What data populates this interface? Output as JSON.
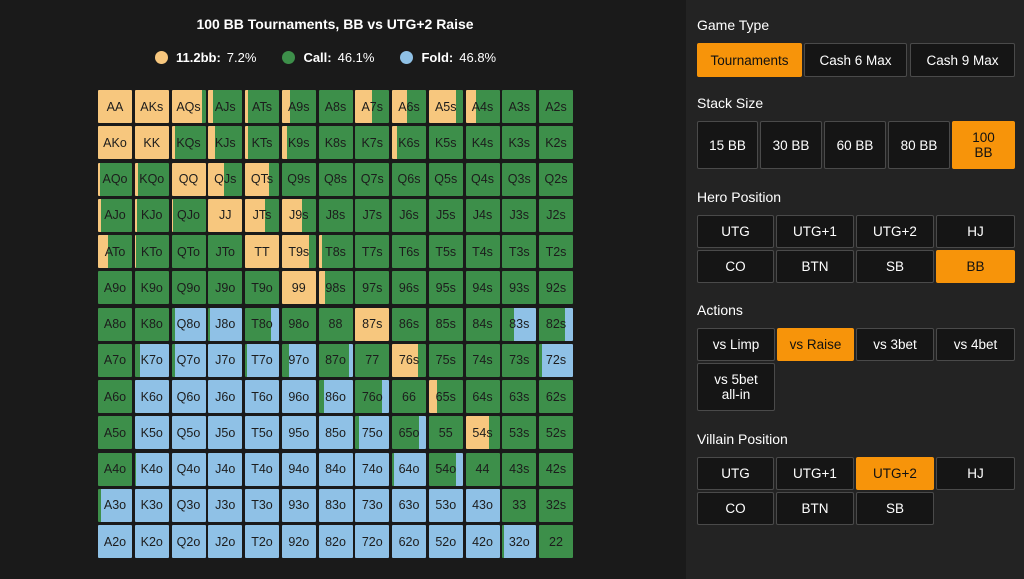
{
  "title": "100 BB Tournaments, BB vs UTG+2 Raise",
  "colors": {
    "raise": "#f7c77e",
    "call": "#3d8f4a",
    "fold": "#8fc1e6",
    "accent": "#f7940a"
  },
  "legend": [
    {
      "label": "11.2bb:",
      "pct": "7.2%",
      "color": "#f7c77e"
    },
    {
      "label": "Call:",
      "pct": "46.1%",
      "color": "#3d8f4a"
    },
    {
      "label": "Fold:",
      "pct": "46.8%",
      "color": "#8fc1e6"
    }
  ],
  "grid": [
    [
      [
        "AA",
        1,
        0
      ],
      [
        "AKs",
        1,
        0
      ],
      [
        "AQs",
        0.9,
        0.1
      ],
      [
        "AJs",
        0.15,
        0.85
      ],
      [
        "ATs",
        0.1,
        0.9
      ],
      [
        "A9s",
        0.25,
        0.75
      ],
      [
        "A8s",
        0,
        1
      ],
      [
        "A7s",
        0.5,
        0.5
      ],
      [
        "A6s",
        0.45,
        0.55
      ],
      [
        "A5s",
        0.8,
        0.2
      ],
      [
        "A4s",
        0.3,
        0.7
      ],
      [
        "A3s",
        0,
        1
      ],
      [
        "A2s",
        0,
        1
      ]
    ],
    [
      [
        "AKo",
        1,
        0
      ],
      [
        "KK",
        1,
        0
      ],
      [
        "KQs",
        0.1,
        0.9
      ],
      [
        "KJs",
        0.2,
        0.8
      ],
      [
        "KTs",
        0.1,
        0.9
      ],
      [
        "K9s",
        0.15,
        0.85
      ],
      [
        "K8s",
        0,
        1
      ],
      [
        "K7s",
        0,
        1
      ],
      [
        "K6s",
        0.15,
        0.85
      ],
      [
        "K5s",
        0,
        1
      ],
      [
        "K4s",
        0,
        1
      ],
      [
        "K3s",
        0,
        1
      ],
      [
        "K2s",
        0,
        1
      ]
    ],
    [
      [
        "AQo",
        0.05,
        0.95
      ],
      [
        "KQo",
        0.1,
        0.9
      ],
      [
        "QQ",
        1,
        0
      ],
      [
        "QJs",
        0.45,
        0.55
      ],
      [
        "QTs",
        0.7,
        0.3
      ],
      [
        "Q9s",
        0,
        1
      ],
      [
        "Q8s",
        0,
        1
      ],
      [
        "Q7s",
        0,
        1
      ],
      [
        "Q6s",
        0,
        1
      ],
      [
        "Q5s",
        0,
        1
      ],
      [
        "Q4s",
        0,
        1
      ],
      [
        "Q3s",
        0,
        1
      ],
      [
        "Q2s",
        0,
        1
      ]
    ],
    [
      [
        "AJo",
        0.1,
        0.9
      ],
      [
        "KJo",
        0.08,
        0.92
      ],
      [
        "QJo",
        0.05,
        0.95
      ],
      [
        "JJ",
        1,
        0
      ],
      [
        "JTs",
        0.6,
        0.4
      ],
      [
        "J9s",
        0.6,
        0.4
      ],
      [
        "J8s",
        0,
        1
      ],
      [
        "J7s",
        0,
        1
      ],
      [
        "J6s",
        0,
        1
      ],
      [
        "J5s",
        0,
        1
      ],
      [
        "J4s",
        0,
        1
      ],
      [
        "J3s",
        0,
        1
      ],
      [
        "J2s",
        0,
        1
      ]
    ],
    [
      [
        "ATo",
        0.3,
        0.7
      ],
      [
        "KTo",
        0.05,
        0.95
      ],
      [
        "QTo",
        0,
        1
      ],
      [
        "JTo",
        0,
        1
      ],
      [
        "TT",
        1,
        0
      ],
      [
        "T9s",
        0.8,
        0.2
      ],
      [
        "T8s",
        0.1,
        0.9
      ],
      [
        "T7s",
        0,
        1
      ],
      [
        "T6s",
        0,
        1
      ],
      [
        "T5s",
        0,
        1
      ],
      [
        "T4s",
        0,
        1
      ],
      [
        "T3s",
        0,
        1
      ],
      [
        "T2s",
        0,
        1
      ]
    ],
    [
      [
        "A9o",
        0,
        1
      ],
      [
        "K9o",
        0,
        1
      ],
      [
        "Q9o",
        0,
        1
      ],
      [
        "J9o",
        0,
        1
      ],
      [
        "T9o",
        0,
        1
      ],
      [
        "99",
        1,
        0
      ],
      [
        "98s",
        0.2,
        0.8
      ],
      [
        "97s",
        0,
        1
      ],
      [
        "96s",
        0,
        1
      ],
      [
        "95s",
        0,
        1
      ],
      [
        "94s",
        0,
        1
      ],
      [
        "93s",
        0,
        1
      ],
      [
        "92s",
        0,
        1
      ]
    ],
    [
      [
        "A8o",
        0,
        1
      ],
      [
        "K8o",
        0,
        1
      ],
      [
        "Q8o",
        0,
        0.1
      ],
      [
        "J8o",
        0,
        0.05
      ],
      [
        "T8o",
        0,
        0.75
      ],
      [
        "98o",
        0,
        1
      ],
      [
        "88",
        0,
        1
      ],
      [
        "87s",
        1,
        0
      ],
      [
        "86s",
        0,
        1
      ],
      [
        "85s",
        0,
        1
      ],
      [
        "84s",
        0,
        1
      ],
      [
        "83s",
        0,
        0.35
      ],
      [
        "82s",
        0,
        0.75
      ]
    ],
    [
      [
        "A7o",
        0,
        1
      ],
      [
        "K7o",
        0,
        0.15
      ],
      [
        "Q7o",
        0,
        0.1
      ],
      [
        "J7o",
        0,
        0
      ],
      [
        "T7o",
        0,
        0.05
      ],
      [
        "97o",
        0,
        0.2
      ],
      [
        "87o",
        0,
        0.9
      ],
      [
        "77",
        0,
        1
      ],
      [
        "76s",
        0.75,
        0.25
      ],
      [
        "75s",
        0,
        1
      ],
      [
        "74s",
        0,
        1
      ],
      [
        "73s",
        0,
        1
      ],
      [
        "72s",
        0,
        0.1
      ]
    ],
    [
      [
        "A6o",
        0,
        1
      ],
      [
        "K6o",
        0,
        0
      ],
      [
        "Q6o",
        0,
        0
      ],
      [
        "J6o",
        0,
        0
      ],
      [
        "T6o",
        0,
        0
      ],
      [
        "96o",
        0,
        0
      ],
      [
        "86o",
        0,
        0.15
      ],
      [
        "76o",
        0,
        0.8
      ],
      [
        "66",
        0,
        1
      ],
      [
        "65s",
        0.25,
        0.75
      ],
      [
        "64s",
        0,
        1
      ],
      [
        "63s",
        0,
        1
      ],
      [
        "62s",
        0,
        1
      ]
    ],
    [
      [
        "A5o",
        0,
        1
      ],
      [
        "K5o",
        0,
        0
      ],
      [
        "Q5o",
        0,
        0
      ],
      [
        "J5o",
        0,
        0
      ],
      [
        "T5o",
        0,
        0
      ],
      [
        "95o",
        0,
        0
      ],
      [
        "85o",
        0,
        0
      ],
      [
        "75o",
        0,
        0.1
      ],
      [
        "65o",
        0,
        0.8
      ],
      [
        "55",
        0,
        1
      ],
      [
        "54s",
        0.7,
        0.3
      ],
      [
        "53s",
        0,
        1
      ],
      [
        "52s",
        0,
        1
      ]
    ],
    [
      [
        "A4o",
        0,
        1
      ],
      [
        "K4o",
        0,
        0.05
      ],
      [
        "Q4o",
        0,
        0
      ],
      [
        "J4o",
        0,
        0
      ],
      [
        "T4o",
        0,
        0
      ],
      [
        "94o",
        0,
        0
      ],
      [
        "84o",
        0,
        0
      ],
      [
        "74o",
        0,
        0
      ],
      [
        "64o",
        0,
        0.05
      ],
      [
        "54o",
        0,
        0.8
      ],
      [
        "44",
        0,
        1
      ],
      [
        "43s",
        0,
        1
      ],
      [
        "42s",
        0,
        1
      ]
    ],
    [
      [
        "A3o",
        0,
        0.1
      ],
      [
        "K3o",
        0,
        0
      ],
      [
        "Q3o",
        0,
        0
      ],
      [
        "J3o",
        0,
        0
      ],
      [
        "T3o",
        0,
        0
      ],
      [
        "93o",
        0,
        0
      ],
      [
        "83o",
        0,
        0
      ],
      [
        "73o",
        0,
        0
      ],
      [
        "63o",
        0,
        0
      ],
      [
        "53o",
        0,
        0
      ],
      [
        "43o",
        0,
        0
      ],
      [
        "33",
        0,
        1
      ],
      [
        "32s",
        0,
        1
      ]
    ],
    [
      [
        "A2o",
        0,
        0
      ],
      [
        "K2o",
        0,
        0
      ],
      [
        "Q2o",
        0,
        0
      ],
      [
        "J2o",
        0,
        0
      ],
      [
        "T2o",
        0,
        0
      ],
      [
        "92o",
        0,
        0
      ],
      [
        "82o",
        0,
        0
      ],
      [
        "72o",
        0,
        0
      ],
      [
        "62o",
        0,
        0
      ],
      [
        "52o",
        0,
        0
      ],
      [
        "42o",
        0,
        0
      ],
      [
        "32o",
        0,
        0.05
      ],
      [
        "22",
        0,
        1
      ]
    ]
  ],
  "panel": {
    "game_type": {
      "title": "Game Type",
      "options": [
        "Tournaments",
        "Cash 6 Max",
        "Cash 9 Max"
      ],
      "selected": 0
    },
    "stack_size": {
      "title": "Stack Size",
      "options": [
        "15 BB",
        "30 BB",
        "60 BB",
        "80 BB",
        "100 BB"
      ],
      "selected": 4
    },
    "hero_position": {
      "title": "Hero Position",
      "options": [
        "UTG",
        "UTG+1",
        "UTG+2",
        "HJ",
        "CO",
        "BTN",
        "SB",
        "BB"
      ],
      "selected": 7
    },
    "actions": {
      "title": "Actions",
      "options": [
        "vs Limp",
        "vs Raise",
        "vs 3bet",
        "vs 4bet",
        "vs 5bet all-in"
      ],
      "selected": 1
    },
    "villain_position": {
      "title": "Villain Position",
      "options": [
        "UTG",
        "UTG+1",
        "UTG+2",
        "HJ",
        "CO",
        "BTN",
        "SB"
      ],
      "selected": 2
    }
  }
}
